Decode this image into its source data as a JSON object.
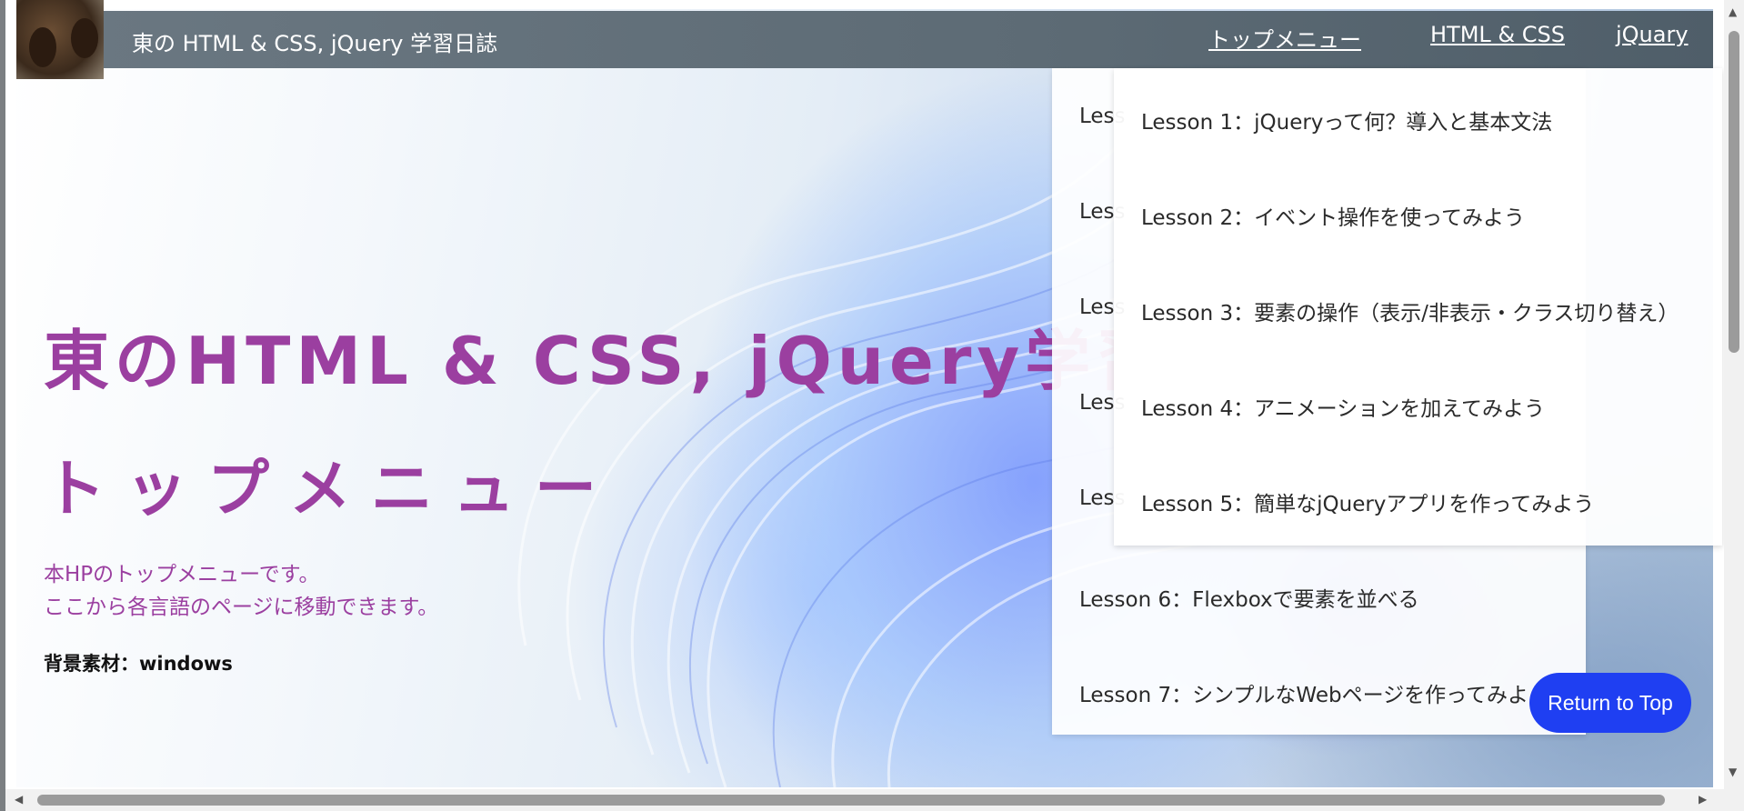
{
  "header": {
    "site_title": "東の HTML & CSS, jQuery 学習日誌",
    "nav": [
      "トップメニュー",
      "HTML & CSS",
      "jQuary"
    ]
  },
  "main": {
    "heading": "東のHTML & CSS, jQuery学習日誌",
    "subheading": "トップメニュー",
    "description_line1": "本HPのトップメニューです。",
    "description_line2": "ここから各言語のページに移動できます。",
    "credit": "背景素材：windows"
  },
  "dropdown_htmlcss": {
    "items": [
      "Less",
      "Less",
      "Less",
      "Less",
      "Less",
      "Lesson 6：Flexboxで要素を並べる",
      "Lesson 7：シンプルなWebページを作ってみよう"
    ]
  },
  "dropdown_jquery": {
    "items": [
      "Lesson 1：jQueryって何？導入と基本文法",
      "Lesson 2：イベント操作を使ってみよう",
      "Lesson 3：要素の操作（表示/非表示・クラス切り替え）",
      "Lesson 4：アニメーションを加えてみよう",
      "Lesson 5：簡単なjQueryアプリを作ってみよう"
    ]
  },
  "return_button": "Return to Top",
  "colors": {
    "accent_purple": "#9b3fa0",
    "topbar": "#5d6b75",
    "button_blue": "#1f3ff2"
  }
}
